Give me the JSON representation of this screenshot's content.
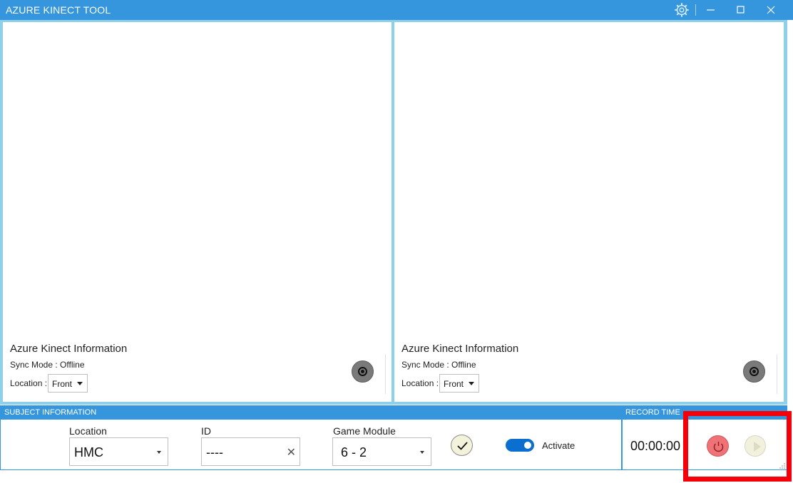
{
  "window": {
    "title": "AZURE KINECT TOOL",
    "icons": {
      "settings": "gear-icon",
      "minimize": "minimize-icon",
      "maximize": "maximize-icon",
      "close": "close-icon"
    }
  },
  "panels": [
    {
      "heading": "Azure Kinect Information",
      "sync": "Sync Mode : Offline",
      "location_label": "Location :",
      "location_value": "Front",
      "camera_icon": "record-camera-icon"
    },
    {
      "heading": "Azure Kinect Information",
      "sync": "Sync Mode : Offline",
      "location_label": "Location :",
      "location_value": "Front",
      "camera_icon": "record-camera-icon"
    }
  ],
  "subject": {
    "section_label": "SUBJECT INFORMATION",
    "location_label": "Location",
    "location_value": "HMC",
    "id_label": "ID",
    "id_value": "----",
    "game_label": "Game Module",
    "game_value": "6 - 2",
    "activate_label": "Activate",
    "activate_on": true
  },
  "record": {
    "section_label": "RECORD TIME",
    "time": "00:00:00"
  },
  "colors": {
    "accent": "#3595dd",
    "panel_border": "#8ed0ea",
    "toggle_on": "#0b6fcf",
    "power": "#ef7277",
    "highlight": "#f5000a"
  }
}
